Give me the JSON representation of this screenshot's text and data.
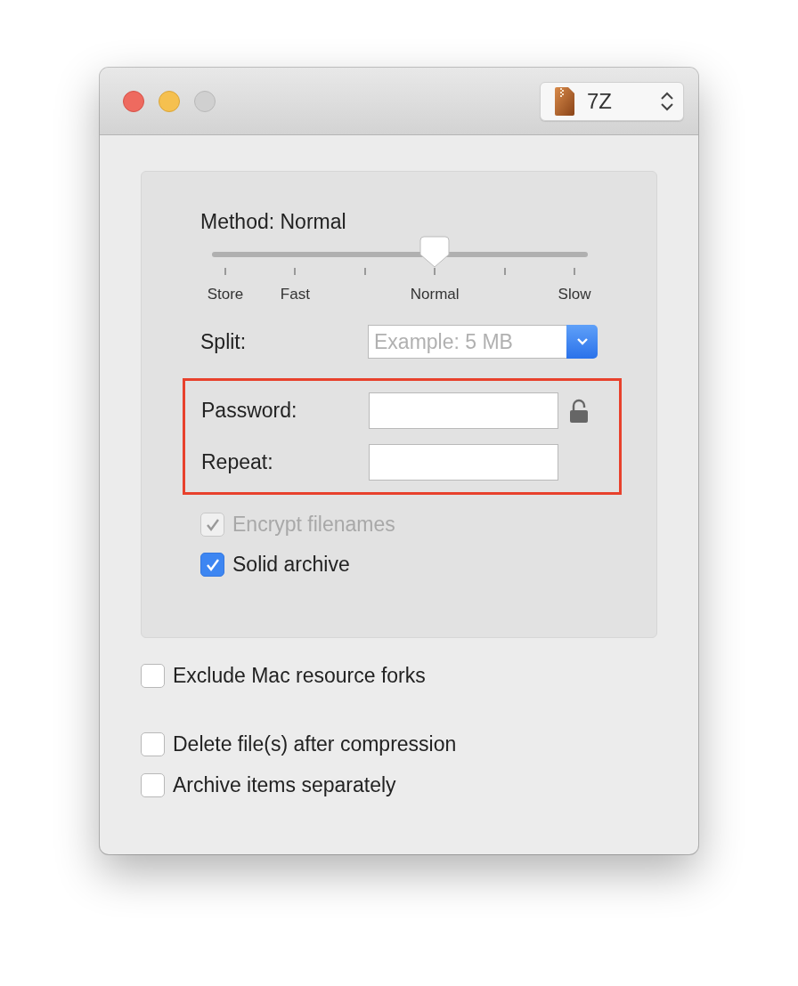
{
  "format_selector": {
    "value": "7Z"
  },
  "method": {
    "label": "Method: Normal",
    "level": 0.6,
    "ticks": [
      {
        "kind": "labeled",
        "label": "Store"
      },
      {
        "kind": "labeled",
        "label": "Fast"
      },
      {
        "kind": "plain"
      },
      {
        "kind": "labeled",
        "label": "Normal"
      },
      {
        "kind": "plain"
      },
      {
        "kind": "labeled",
        "label": "Slow"
      }
    ]
  },
  "split": {
    "label": "Split:",
    "placeholder": "Example: 5 MB"
  },
  "password_section": {
    "highlighted": true,
    "password_label": "Password:",
    "repeat_label": "Repeat:",
    "locked": false
  },
  "panel_options": [
    {
      "label": "Encrypt filenames",
      "checked": true,
      "disabled": true
    },
    {
      "label": "Solid archive",
      "checked": true,
      "disabled": false
    }
  ],
  "option_groups": [
    [
      {
        "label": "Exclude Mac resource forks",
        "checked": false
      }
    ],
    [
      {
        "label": "Delete file(s) after compression",
        "checked": false
      },
      {
        "label": "Archive items separately",
        "checked": false
      }
    ]
  ]
}
